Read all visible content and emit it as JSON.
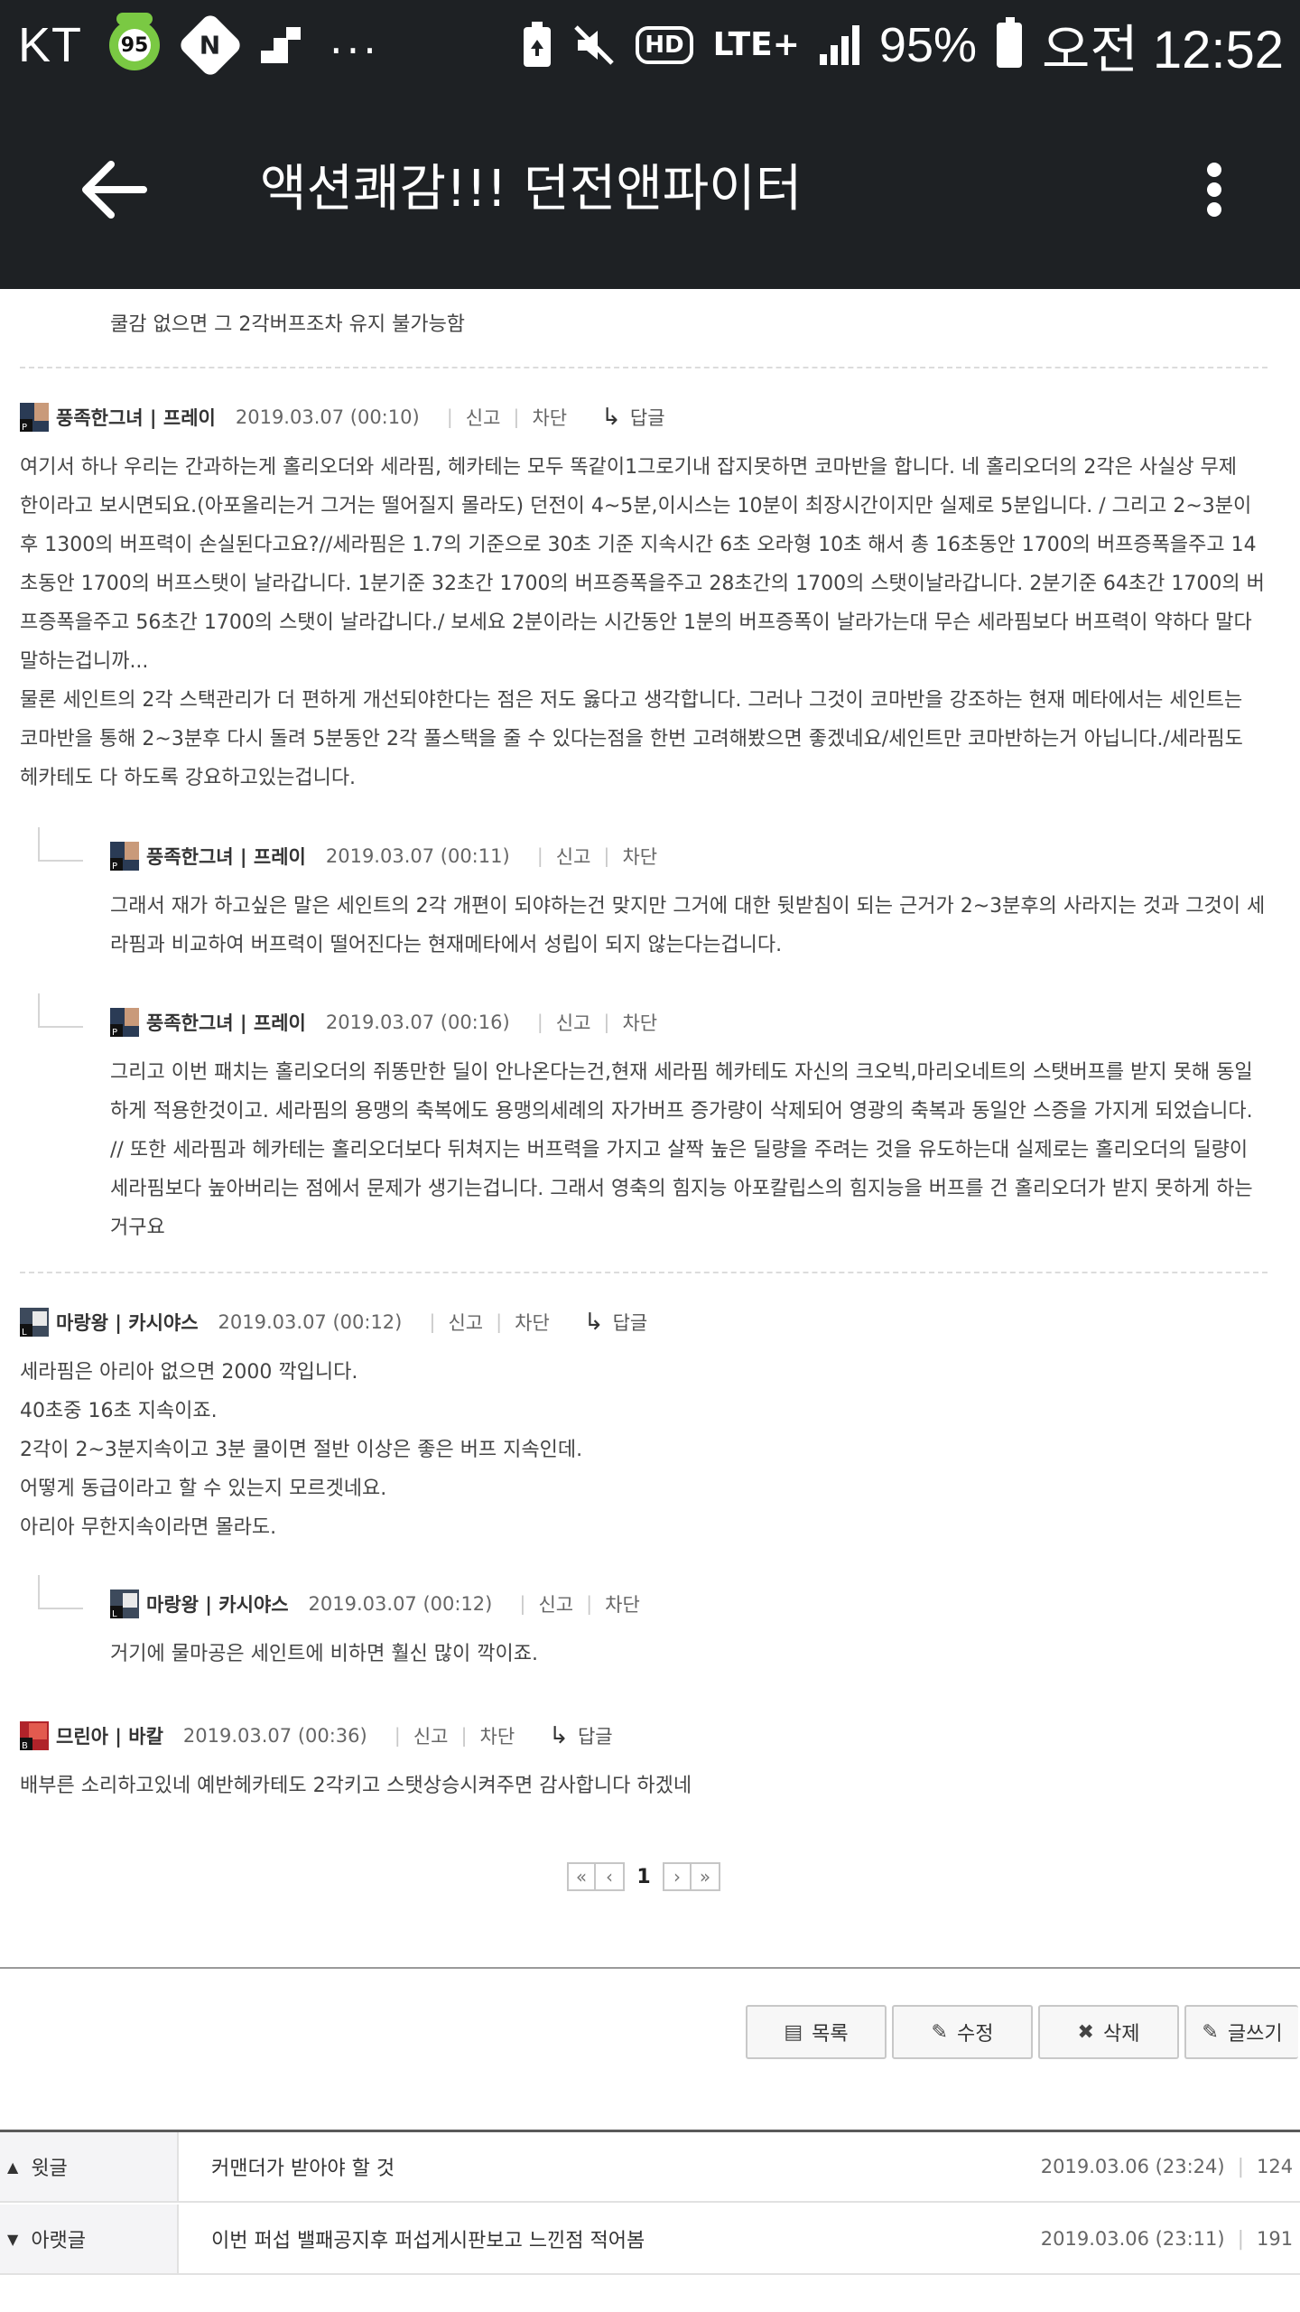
{
  "status_bar": {
    "carrier": "KT",
    "badge_count": "95",
    "n_app": "N",
    "more": "...",
    "hd": "HD",
    "network": "LTE+",
    "battery": "95%",
    "time": "오전 12:52"
  },
  "app_bar": {
    "title": "액션쾌감!!! 던전앤파이터"
  },
  "comments": {
    "top_line": "쿨감 없으면 그 2각버프조차 유지 불가능함",
    "c1": {
      "author": "풍족한그녀 | 프레이",
      "date": "2019.03.07 (00:10)",
      "report": "신고",
      "block": "차단",
      "reply": "답글",
      "lines": [
        "여기서 하나 우리는 간과하는게 홀리오더와 세라핌, 헤카테는 모두 똑같이1그로기내 잡지못하면 코마반을 합니다. 네 홀리오더의 2각은 사실상 무제",
        "한이라고 보시면되요.(아포올리는거 그거는 떨어질지 몰라도) 던전이 4~5분,이시스는 10분이 최장시간이지만 실제로 5분입니다. / 그리고 2~3분이",
        "후 1300의 버프력이 손실된다고요?//세라핌은 1.7의 기준으로 30초 기준 지속시간 6초 오라형 10초 해서 총 16초동안 1700의 버프증폭을주고 14",
        "초동안 1700의 버프스탯이 날라갑니다. 1분기준 32초간 1700의 버프증폭을주고 28초간의 1700의 스탯이날라갑니다. 2분기준 64초간 1700의 버",
        "프증폭을주고 56초간 1700의 스탯이 날라갑니다./ 보세요 2분이라는 시간동안 1분의 버프증폭이 날라가는대 무슨 세라핌보다 버프력이 약하다 말다",
        "말하는겁니까...",
        "물론 세인트의 2각 스택관리가 더 편하게 개선되야한다는 점은 저도 옳다고 생각합니다. 그러나 그것이 코마반을 강조하는 현재 메타에서는 세인트는",
        "코마반을 통해 2~3분후 다시 돌려 5분동안 2각 풀스택을 줄 수 있다는점을 한번 고려해봤으면 좋겠네요/세인트만 코마반하는거 아닙니다./세라핌도",
        "헤카테도 다 하도록 강요하고있는겁니다."
      ]
    },
    "c1_r1": {
      "author": "풍족한그녀 | 프레이",
      "date": "2019.03.07 (00:11)",
      "report": "신고",
      "block": "차단",
      "lines": [
        "그래서 재가 하고싶은 말은 세인트의 2각 개편이 되야하는건 맞지만 그거에 대한 뒷받침이 되는 근거가 2~3분후의 사라지는 것과 그것이 세",
        "라핌과 비교하여 버프력이 떨어진다는 현재메타에서 성립이 되지 않는다는겁니다."
      ]
    },
    "c1_r2": {
      "author": "풍족한그녀 | 프레이",
      "date": "2019.03.07 (00:16)",
      "report": "신고",
      "block": "차단",
      "lines": [
        "그리고 이번 패치는 홀리오더의 쥐똥만한 딜이 안나온다는건,현재 세라핌 헤카테도 자신의 크오빅,마리오네트의 스탯버프를 받지 못해 동일",
        "하게 적용한것이고. 세라핌의 용맹의 축복에도 용맹의세례의 자가버프 증가량이 삭제되어 영광의 축복과 동일안 스증을 가지게 되었습니다.",
        "// 또한 세라핌과 헤카테는 홀리오더보다 뒤쳐지는 버프력을 가지고 살짝 높은 딜량을 주려는 것을 유도하는대 실제로는 홀리오더의 딜량이",
        "세라핌보다 높아버리는 점에서 문제가 생기는겁니다. 그래서 영축의 힘지능 아포칼립스의 힘지능을 버프를 건 홀리오더가 받지 못하게 하는",
        "거구요"
      ]
    },
    "c2": {
      "author": "마랑왕 | 카시야스",
      "date": "2019.03.07 (00:12)",
      "report": "신고",
      "block": "차단",
      "reply": "답글",
      "lines": [
        "세라핌은 아리아 없으면 2000 깍입니다.",
        "40초중 16초 지속이죠.",
        "2각이 2~3분지속이고 3분 쿨이면 절반 이상은 좋은 버프 지속인데.",
        "어떻게 동급이라고 할 수 있는지 모르겟네요.",
        "아리아 무한지속이라면 몰라도."
      ]
    },
    "c2_r1": {
      "author": "마랑왕 | 카시야스",
      "date": "2019.03.07 (00:12)",
      "report": "신고",
      "block": "차단",
      "lines": [
        "거기에 물마공은 세인트에 비하면 훨신 많이 깍이죠."
      ]
    },
    "c3": {
      "author": "므린아 | 바칼",
      "date": "2019.03.07 (00:36)",
      "report": "신고",
      "block": "차단",
      "reply": "답글",
      "lines": [
        "배부른 소리하고있네 예반헤카테도 2각키고 스탯상승시켜주면 감사합니다 하겠네"
      ]
    }
  },
  "pagination": {
    "first": "«",
    "prev": "‹",
    "current": "1",
    "next": "›",
    "last": "»"
  },
  "actions": {
    "list": "목록",
    "edit": "수정",
    "delete": "삭제",
    "write": "글쓰기"
  },
  "post_nav": {
    "prev_label": "윗글",
    "prev_title": "커맨더가 받아야 할 것",
    "prev_date": "2019.03.06 (23:24)",
    "prev_views": "124",
    "next_label": "아랫글",
    "next_title": "이번 퍼섭 밸패공지후 퍼섭게시판보고 느낀점 적어봄",
    "next_date": "2019.03.06 (23:11)",
    "next_views": "191"
  }
}
